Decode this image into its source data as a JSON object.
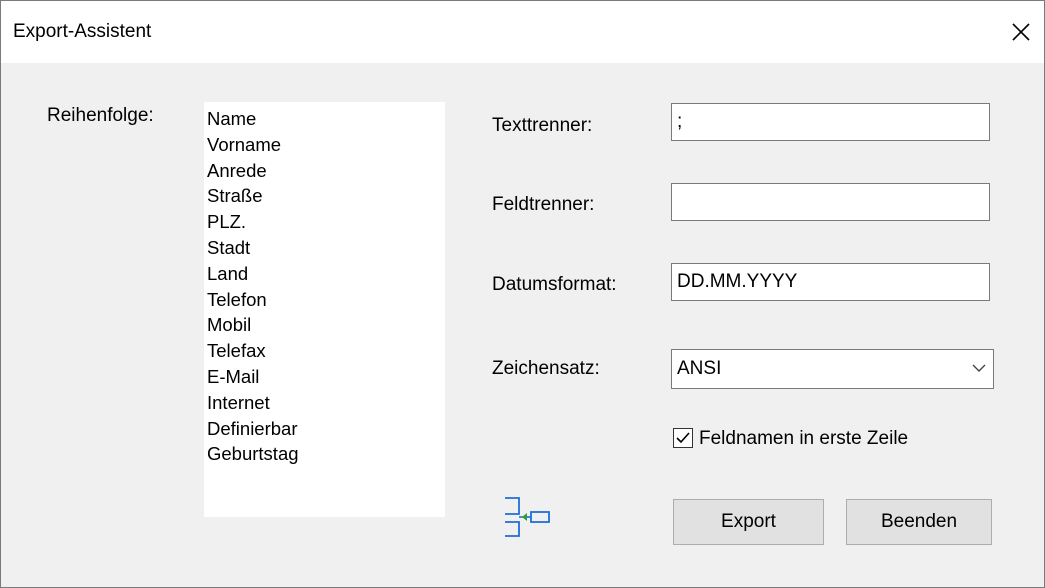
{
  "window": {
    "title": "Export-Assistent"
  },
  "order": {
    "label": "Reihenfolge:",
    "items": [
      "Name",
      "Vorname",
      "Anrede",
      "Straße",
      "PLZ.",
      "Stadt",
      "Land",
      "Telefon",
      "Mobil",
      "Telefax",
      "E-Mail",
      "Internet",
      "Definierbar",
      "Geburtstag"
    ]
  },
  "fields": {
    "text_separator": {
      "label": "Texttrenner:",
      "value": ";"
    },
    "field_separator": {
      "label": "Feldtrenner:",
      "value": ""
    },
    "date_format": {
      "label": "Datumsformat:",
      "value": "DD.MM.YYYY"
    },
    "charset": {
      "label": "Zeichensatz:",
      "value": "ANSI"
    }
  },
  "header_row": {
    "label": "Feldnamen in erste Zeile",
    "checked": true
  },
  "buttons": {
    "export": "Export",
    "close": "Beenden"
  },
  "icons": {
    "close": "close-icon",
    "chevron": "chevron-down-icon",
    "check": "check-icon",
    "fields": "field-mapping-icon"
  },
  "colors": {
    "window_bg": "#f0f0f0",
    "icon_accent": "#1e6fd9",
    "arrow_green": "#2e9e3a"
  }
}
